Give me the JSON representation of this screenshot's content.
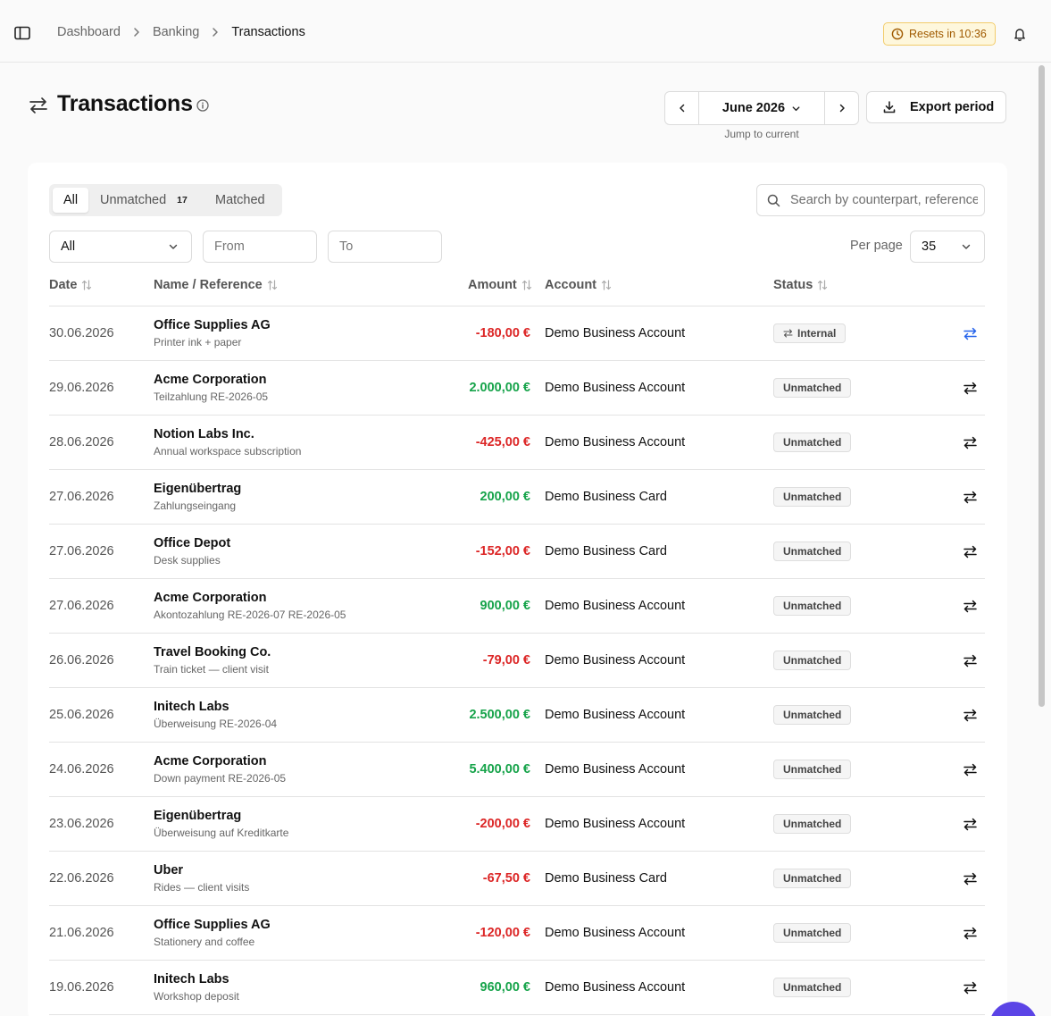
{
  "breadcrumb": {
    "items": [
      {
        "label": "Dashboard"
      },
      {
        "label": "Banking"
      },
      {
        "label": "Transactions"
      }
    ]
  },
  "reset_badge": "Resets in 10:36",
  "page": {
    "title": "Transactions"
  },
  "period": {
    "label": "June 2026",
    "jump": "Jump to current"
  },
  "export_label": "Export period",
  "tabs": {
    "all": "All",
    "unmatched": "Unmatched",
    "unmatched_count": "17",
    "matched": "Matched"
  },
  "search": {
    "placeholder": "Search by counterpart, reference"
  },
  "filters": {
    "account_select": "All",
    "from_placeholder": "From",
    "to_placeholder": "To",
    "per_page_label": "Per page",
    "per_page_value": "35"
  },
  "table": {
    "headers": {
      "date": "Date",
      "name": "Name / Reference",
      "amount": "Amount",
      "account": "Account",
      "status": "Status"
    },
    "rows": [
      {
        "date": "30.06.2026",
        "name": "Office Supplies AG",
        "ref": "Printer ink + paper",
        "amount": "-180,00 €",
        "account": "Demo Business Account",
        "status": "Internal"
      },
      {
        "date": "29.06.2026",
        "name": "Acme Corporation",
        "ref": "Teilzahlung RE-2026-05",
        "amount": "2.000,00 €",
        "account": "Demo Business Account",
        "status": "Unmatched"
      },
      {
        "date": "28.06.2026",
        "name": "Notion Labs Inc.",
        "ref": "Annual workspace subscription",
        "amount": "-425,00 €",
        "account": "Demo Business Account",
        "status": "Unmatched"
      },
      {
        "date": "27.06.2026",
        "name": "Eigenübertrag",
        "ref": "Zahlungseingang",
        "amount": "200,00 €",
        "account": "Demo Business Card",
        "status": "Unmatched"
      },
      {
        "date": "27.06.2026",
        "name": "Office Depot",
        "ref": "Desk supplies",
        "amount": "-152,00 €",
        "account": "Demo Business Card",
        "status": "Unmatched"
      },
      {
        "date": "27.06.2026",
        "name": "Acme Corporation",
        "ref": "Akontozahlung RE-2026-07 RE-2026-05",
        "amount": "900,00 €",
        "account": "Demo Business Account",
        "status": "Unmatched"
      },
      {
        "date": "26.06.2026",
        "name": "Travel Booking Co.",
        "ref": "Train ticket — client visit",
        "amount": "-79,00 €",
        "account": "Demo Business Account",
        "status": "Unmatched"
      },
      {
        "date": "25.06.2026",
        "name": "Initech Labs",
        "ref": "Überweisung RE-2026-04",
        "amount": "2.500,00 €",
        "account": "Demo Business Account",
        "status": "Unmatched"
      },
      {
        "date": "24.06.2026",
        "name": "Acme Corporation",
        "ref": "Down payment RE-2026-05",
        "amount": "5.400,00 €",
        "account": "Demo Business Account",
        "status": "Unmatched"
      },
      {
        "date": "23.06.2026",
        "name": "Eigenübertrag",
        "ref": "Überweisung auf Kreditkarte",
        "amount": "-200,00 €",
        "account": "Demo Business Account",
        "status": "Unmatched"
      },
      {
        "date": "22.06.2026",
        "name": "Uber",
        "ref": "Rides — client visits",
        "amount": "-67,50 €",
        "account": "Demo Business Card",
        "status": "Unmatched"
      },
      {
        "date": "21.06.2026",
        "name": "Office Supplies AG",
        "ref": "Stationery and coffee",
        "amount": "-120,00 €",
        "account": "Demo Business Account",
        "status": "Unmatched"
      },
      {
        "date": "19.06.2026",
        "name": "Initech Labs",
        "ref": "Workshop deposit",
        "amount": "960,00 €",
        "account": "Demo Business Account",
        "status": "Unmatched"
      }
    ]
  },
  "colors": {
    "negative": "#dc2626",
    "positive": "#16a34a",
    "link_icon": "#2563eb",
    "badge_warning_bg": "#fef7dc",
    "fab": "#5b44e6"
  },
  "icons": {
    "sidebar_toggle": "sidebar-icon",
    "notifications": "bell-icon",
    "reset": "clock-icon",
    "page": "transfer-arrows-icon",
    "info": "info-icon",
    "export": "download-icon",
    "search": "search-icon",
    "row_action": "match-arrows-icon"
  }
}
